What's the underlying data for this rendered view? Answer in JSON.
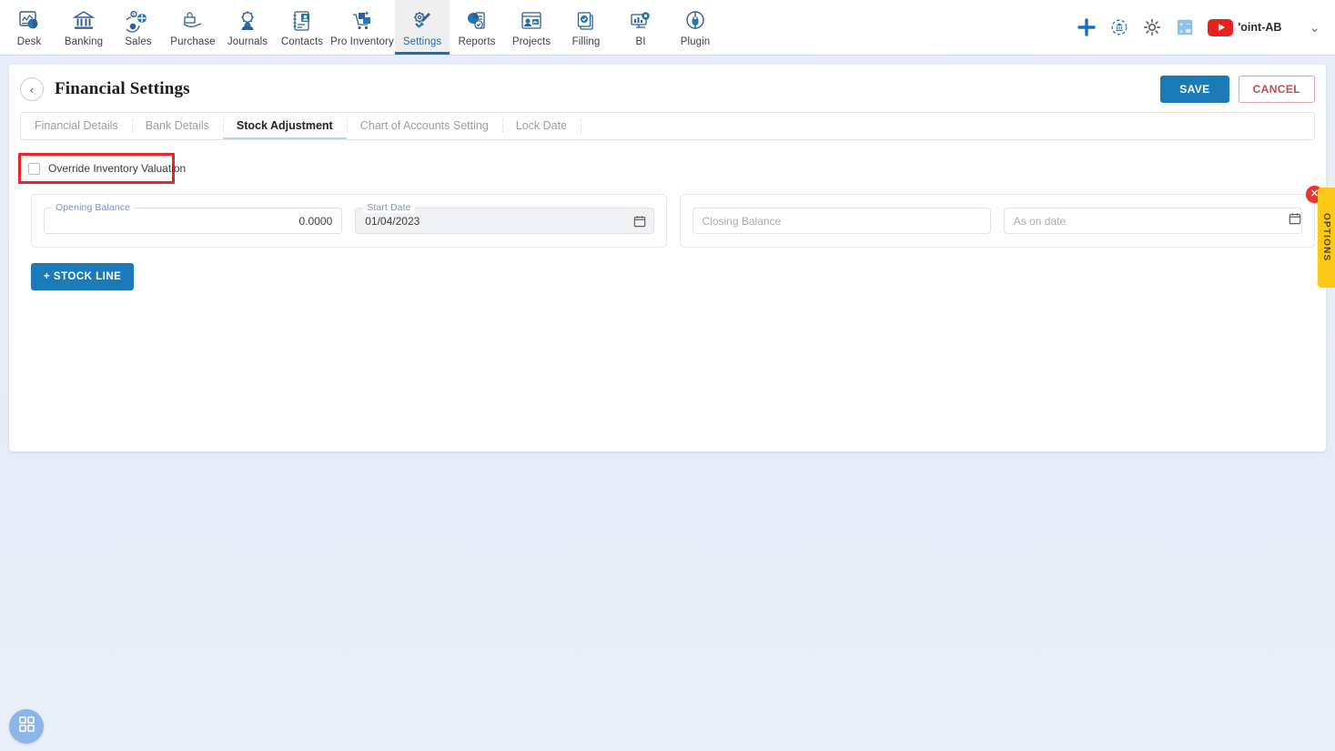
{
  "topnav": {
    "items": [
      {
        "label": "Desk",
        "icon": "dashboard-icon",
        "active": false
      },
      {
        "label": "Banking",
        "icon": "bank-icon",
        "active": false
      },
      {
        "label": "Sales",
        "icon": "sales-icon",
        "active": false
      },
      {
        "label": "Purchase",
        "icon": "purchase-icon",
        "active": false
      },
      {
        "label": "Journals",
        "icon": "journals-icon",
        "active": false
      },
      {
        "label": "Contacts",
        "icon": "contacts-icon",
        "active": false
      },
      {
        "label": "Pro Inventory",
        "icon": "inventory-icon",
        "active": false
      },
      {
        "label": "Settings",
        "icon": "settings-icon",
        "active": true
      },
      {
        "label": "Reports",
        "icon": "reports-icon",
        "active": false
      },
      {
        "label": "Projects",
        "icon": "projects-icon",
        "active": false
      },
      {
        "label": "Filling",
        "icon": "filling-icon",
        "active": false
      },
      {
        "label": "BI",
        "icon": "bi-icon",
        "active": false
      },
      {
        "label": "Plugin",
        "icon": "plugin-icon",
        "active": false
      }
    ],
    "right": {
      "add_icon": "plus-icon",
      "bank_sync_icon": "bank-sync-icon",
      "settings_icon": "gear-icon",
      "calculator_icon": "calculator-icon",
      "youtube_icon": "youtube-icon",
      "org_name": "'oint-AB",
      "chevron_icon": "chevron-down-icon",
      "accent_blue": "#1b6fb8",
      "youtube_red": "#e8221f"
    }
  },
  "page": {
    "title": "Financial Settings",
    "back_icon": "chevron-left-icon",
    "save_label": "SAVE",
    "cancel_label": "CANCEL",
    "save_color": "#1b7ab8",
    "cancel_color": "#c64a4a"
  },
  "tabs": [
    {
      "label": "Financial Details",
      "active": false
    },
    {
      "label": "Bank Details",
      "active": false
    },
    {
      "label": "Stock Adjustment",
      "active": true
    },
    {
      "label": "Chart of Accounts Setting",
      "active": false
    },
    {
      "label": "Lock Date",
      "active": false
    }
  ],
  "override": {
    "label": "Override Inventory Valuation",
    "checked": false,
    "highlight_color": "#e8262a"
  },
  "stock_line": {
    "opening_balance": {
      "label": "Opening Balance",
      "value": "0.0000",
      "disabled": false
    },
    "start_date": {
      "label": "Start Date",
      "value": "01/04/2023",
      "disabled": true,
      "calendar_icon": "calendar-icon"
    },
    "closing_balance": {
      "placeholder": "Closing Balance",
      "value": ""
    },
    "as_on_date": {
      "placeholder": "As on date",
      "value": "",
      "calendar_icon": "calendar-icon"
    },
    "delete_icon": "close-icon",
    "delete_color": "#e8352f"
  },
  "add_stock_line_label": "+ STOCK LINE",
  "options_tab": {
    "label": "OPTIONS",
    "color": "#fcc816"
  },
  "fab": {
    "icon": "apps-grid-icon",
    "color": "#8bb6e8"
  }
}
